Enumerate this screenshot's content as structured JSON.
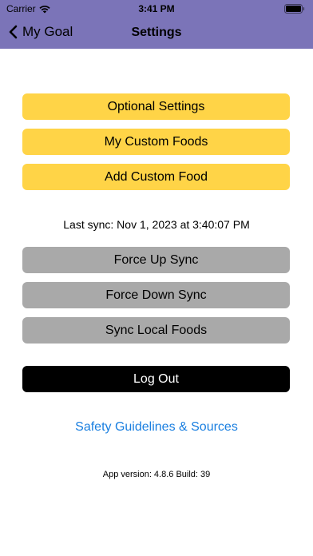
{
  "status_bar": {
    "carrier": "Carrier",
    "time": "3:41 PM"
  },
  "nav": {
    "back_label": "My Goal",
    "title": "Settings"
  },
  "buttons": {
    "optional_settings": "Optional Settings",
    "my_custom_foods": "My Custom Foods",
    "add_custom_food": "Add Custom Food",
    "force_up_sync": "Force Up Sync",
    "force_down_sync": "Force Down Sync",
    "sync_local_foods": "Sync Local Foods",
    "log_out": "Log Out"
  },
  "last_sync": "Last sync: Nov 1, 2023 at 3:40:07 PM",
  "safety_link": "Safety Guidelines & Sources",
  "app_version": "App version: 4.8.6 Build: 39",
  "colors": {
    "header": "#7b74b8",
    "yellow_button": "#ffd447",
    "gray_button": "#a9a9a9",
    "black_button": "#000000",
    "link": "#1a7fe0"
  }
}
